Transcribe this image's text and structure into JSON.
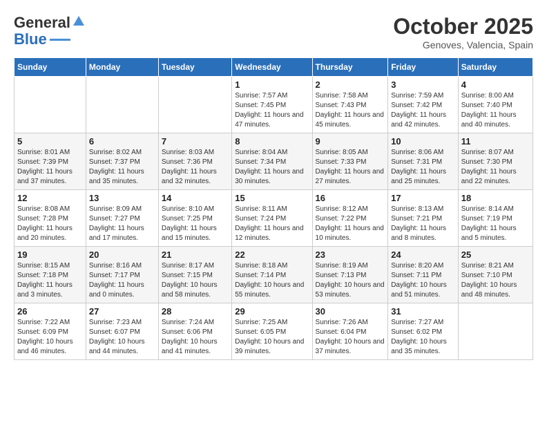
{
  "header": {
    "logo_general": "General",
    "logo_blue": "Blue",
    "title": "October 2025",
    "subtitle": "Genoves, Valencia, Spain"
  },
  "days_of_week": [
    "Sunday",
    "Monday",
    "Tuesday",
    "Wednesday",
    "Thursday",
    "Friday",
    "Saturday"
  ],
  "weeks": [
    [
      {
        "day": "",
        "info": ""
      },
      {
        "day": "",
        "info": ""
      },
      {
        "day": "",
        "info": ""
      },
      {
        "day": "1",
        "info": "Sunrise: 7:57 AM\nSunset: 7:45 PM\nDaylight: 11 hours and 47 minutes."
      },
      {
        "day": "2",
        "info": "Sunrise: 7:58 AM\nSunset: 7:43 PM\nDaylight: 11 hours and 45 minutes."
      },
      {
        "day": "3",
        "info": "Sunrise: 7:59 AM\nSunset: 7:42 PM\nDaylight: 11 hours and 42 minutes."
      },
      {
        "day": "4",
        "info": "Sunrise: 8:00 AM\nSunset: 7:40 PM\nDaylight: 11 hours and 40 minutes."
      }
    ],
    [
      {
        "day": "5",
        "info": "Sunrise: 8:01 AM\nSunset: 7:39 PM\nDaylight: 11 hours and 37 minutes."
      },
      {
        "day": "6",
        "info": "Sunrise: 8:02 AM\nSunset: 7:37 PM\nDaylight: 11 hours and 35 minutes."
      },
      {
        "day": "7",
        "info": "Sunrise: 8:03 AM\nSunset: 7:36 PM\nDaylight: 11 hours and 32 minutes."
      },
      {
        "day": "8",
        "info": "Sunrise: 8:04 AM\nSunset: 7:34 PM\nDaylight: 11 hours and 30 minutes."
      },
      {
        "day": "9",
        "info": "Sunrise: 8:05 AM\nSunset: 7:33 PM\nDaylight: 11 hours and 27 minutes."
      },
      {
        "day": "10",
        "info": "Sunrise: 8:06 AM\nSunset: 7:31 PM\nDaylight: 11 hours and 25 minutes."
      },
      {
        "day": "11",
        "info": "Sunrise: 8:07 AM\nSunset: 7:30 PM\nDaylight: 11 hours and 22 minutes."
      }
    ],
    [
      {
        "day": "12",
        "info": "Sunrise: 8:08 AM\nSunset: 7:28 PM\nDaylight: 11 hours and 20 minutes."
      },
      {
        "day": "13",
        "info": "Sunrise: 8:09 AM\nSunset: 7:27 PM\nDaylight: 11 hours and 17 minutes."
      },
      {
        "day": "14",
        "info": "Sunrise: 8:10 AM\nSunset: 7:25 PM\nDaylight: 11 hours and 15 minutes."
      },
      {
        "day": "15",
        "info": "Sunrise: 8:11 AM\nSunset: 7:24 PM\nDaylight: 11 hours and 12 minutes."
      },
      {
        "day": "16",
        "info": "Sunrise: 8:12 AM\nSunset: 7:22 PM\nDaylight: 11 hours and 10 minutes."
      },
      {
        "day": "17",
        "info": "Sunrise: 8:13 AM\nSunset: 7:21 PM\nDaylight: 11 hours and 8 minutes."
      },
      {
        "day": "18",
        "info": "Sunrise: 8:14 AM\nSunset: 7:19 PM\nDaylight: 11 hours and 5 minutes."
      }
    ],
    [
      {
        "day": "19",
        "info": "Sunrise: 8:15 AM\nSunset: 7:18 PM\nDaylight: 11 hours and 3 minutes."
      },
      {
        "day": "20",
        "info": "Sunrise: 8:16 AM\nSunset: 7:17 PM\nDaylight: 11 hours and 0 minutes."
      },
      {
        "day": "21",
        "info": "Sunrise: 8:17 AM\nSunset: 7:15 PM\nDaylight: 10 hours and 58 minutes."
      },
      {
        "day": "22",
        "info": "Sunrise: 8:18 AM\nSunset: 7:14 PM\nDaylight: 10 hours and 55 minutes."
      },
      {
        "day": "23",
        "info": "Sunrise: 8:19 AM\nSunset: 7:13 PM\nDaylight: 10 hours and 53 minutes."
      },
      {
        "day": "24",
        "info": "Sunrise: 8:20 AM\nSunset: 7:11 PM\nDaylight: 10 hours and 51 minutes."
      },
      {
        "day": "25",
        "info": "Sunrise: 8:21 AM\nSunset: 7:10 PM\nDaylight: 10 hours and 48 minutes."
      }
    ],
    [
      {
        "day": "26",
        "info": "Sunrise: 7:22 AM\nSunset: 6:09 PM\nDaylight: 10 hours and 46 minutes."
      },
      {
        "day": "27",
        "info": "Sunrise: 7:23 AM\nSunset: 6:07 PM\nDaylight: 10 hours and 44 minutes."
      },
      {
        "day": "28",
        "info": "Sunrise: 7:24 AM\nSunset: 6:06 PM\nDaylight: 10 hours and 41 minutes."
      },
      {
        "day": "29",
        "info": "Sunrise: 7:25 AM\nSunset: 6:05 PM\nDaylight: 10 hours and 39 minutes."
      },
      {
        "day": "30",
        "info": "Sunrise: 7:26 AM\nSunset: 6:04 PM\nDaylight: 10 hours and 37 minutes."
      },
      {
        "day": "31",
        "info": "Sunrise: 7:27 AM\nSunset: 6:02 PM\nDaylight: 10 hours and 35 minutes."
      },
      {
        "day": "",
        "info": ""
      }
    ]
  ]
}
